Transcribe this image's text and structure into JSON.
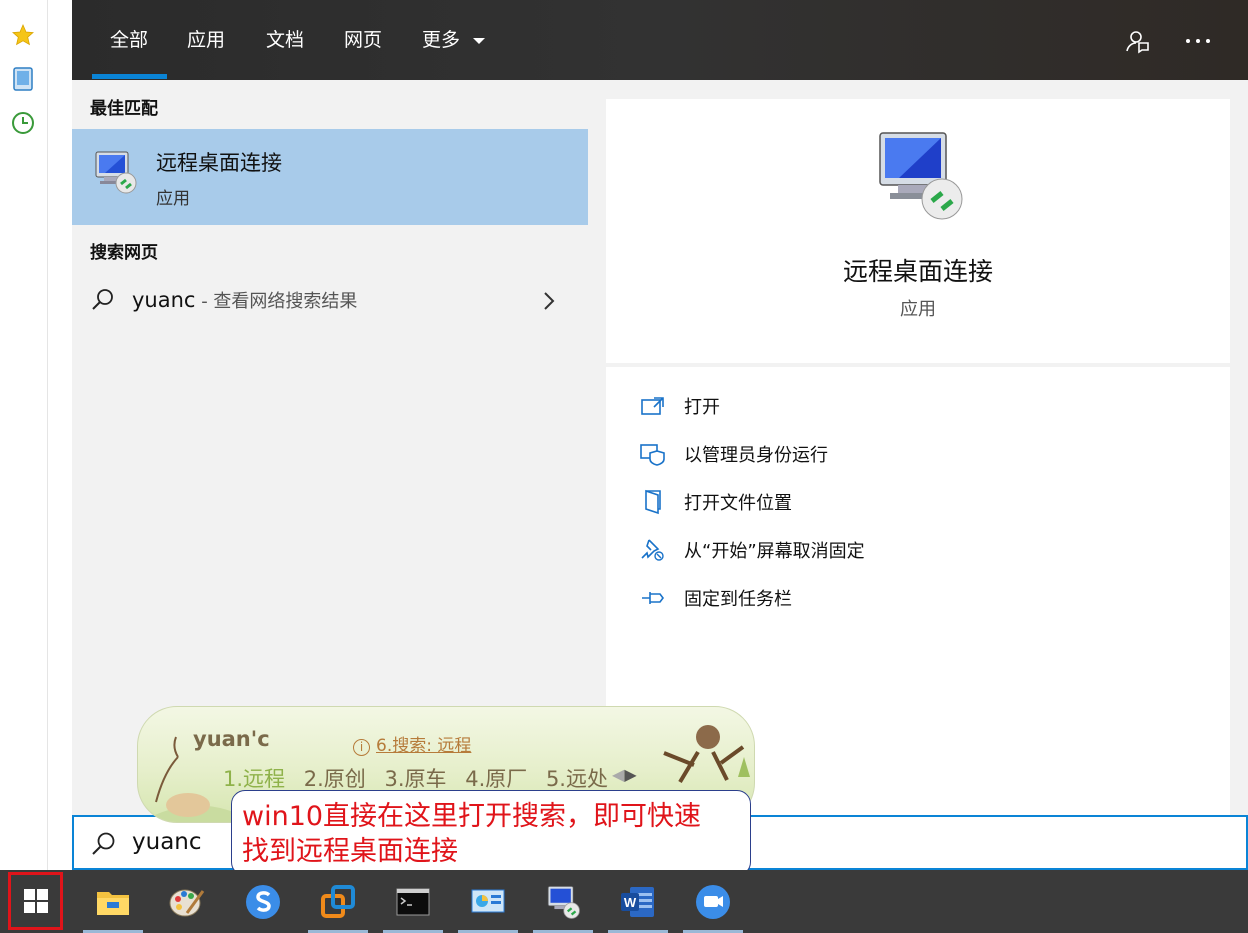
{
  "tabs": [
    {
      "label": "全部"
    },
    {
      "label": "应用"
    },
    {
      "label": "文档"
    },
    {
      "label": "网页"
    },
    {
      "label": "更多"
    }
  ],
  "best_match": {
    "section_title": "最佳匹配",
    "name": "远程桌面连接",
    "type": "应用"
  },
  "web_search": {
    "section_title": "搜索网页",
    "query": "yuanc",
    "suffix": " - 查看网络搜索结果"
  },
  "preview": {
    "name": "远程桌面连接",
    "type": "应用"
  },
  "actions": [
    {
      "label": "打开",
      "icon": "open-icon"
    },
    {
      "label": "以管理员身份运行",
      "icon": "shield-icon"
    },
    {
      "label": "打开文件位置",
      "icon": "folder-location-icon"
    },
    {
      "label": "从“开始”屏幕取消固定",
      "icon": "unpin-icon"
    },
    {
      "label": "固定到任务栏",
      "icon": "pin-icon"
    }
  ],
  "search_box": {
    "value": "yuanc"
  },
  "ime": {
    "composition": "yuan'c",
    "hint": "6.搜索: 远程",
    "candidates": [
      "1.远程",
      "2.原创",
      "3.原车",
      "4.原厂",
      "5.远处"
    ]
  },
  "callout": {
    "text_line1": "win10直接在这里打开搜索，即可快速",
    "text_line2": "找到远程桌面连接"
  },
  "taskbar": {
    "apps": [
      {
        "icon": "file-explorer-icon"
      },
      {
        "icon": "paint-icon"
      },
      {
        "icon": "sogou-input-icon"
      },
      {
        "icon": "vmware-icon"
      },
      {
        "icon": "cmd-icon"
      },
      {
        "icon": "control-panel-icon"
      },
      {
        "icon": "remote-desktop-icon"
      },
      {
        "icon": "word-icon"
      },
      {
        "icon": "meeting-icon"
      }
    ]
  },
  "colors": {
    "accent": "#0a84d6",
    "selection": "#a8cbea",
    "callout_text": "#e0141a",
    "taskbar": "#3a3a3a"
  }
}
